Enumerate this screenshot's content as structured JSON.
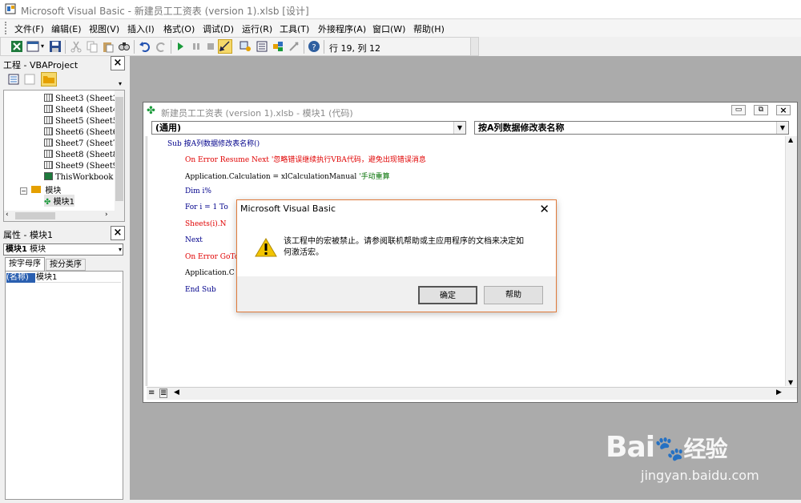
{
  "window": {
    "title": "Microsoft Visual Basic - 新建员工工资表 (version 1).xlsb [设计]"
  },
  "menu": [
    "文件(F)",
    "编辑(E)",
    "视图(V)",
    "插入(I)",
    "格式(O)",
    "调试(D)",
    "运行(R)",
    "工具(T)",
    "外接程序(A)",
    "窗口(W)",
    "帮助(H)"
  ],
  "toolbar": {
    "position": "行 19, 列 12"
  },
  "project_panel": {
    "title": "工程 - VBAProject",
    "items": [
      "Sheet3 (Sheet3",
      "Sheet4 (Sheet4",
      "Sheet5 (Sheet5",
      "Sheet6 (Sheet6",
      "Sheet7 (Sheet7",
      "Sheet8 (Sheet8",
      "Sheet9 (Sheet9",
      "ThisWorkbook"
    ],
    "folder": "模块",
    "module": "模块1"
  },
  "props_panel": {
    "title": "属性 - 模块1",
    "combo_bold": "模块1",
    "combo_rest": "模块",
    "tab_alpha": "按字母序",
    "tab_cat": "按分类序",
    "prop_name": "(名称)",
    "prop_value": "模块1"
  },
  "code_window": {
    "title": "新建员工工资表 (version 1).xlsb - 模块1 (代码)",
    "object_combo": "(通用)",
    "proc_combo": "按A列数据修改表名称",
    "lines": [
      {
        "a": "Sub 按A列数据修改表名称()",
        "b": "",
        "c": ""
      },
      {
        "a": "On Error Resume Next",
        "b": "'忽略错误继续执行VBA代码，避免出现错误消息",
        "c": ""
      },
      {
        "a": "Application.Calculation = xlCalculationManual",
        "b": "'手动重算",
        "c": ""
      },
      {
        "a": "Dim i%",
        "b": "",
        "c": ""
      },
      {
        "a": "For i = 1 To",
        "b": "",
        "c": ""
      },
      {
        "a": "Sheets(i).N",
        "b": "",
        "c": ""
      },
      {
        "a": "Next",
        "b": "",
        "c": ""
      },
      {
        "a": "On Error GoTo",
        "b": "",
        "c": ""
      },
      {
        "a": "Application.C",
        "b": "",
        "c": ""
      },
      {
        "a": "End Sub",
        "b": "",
        "c": ""
      }
    ]
  },
  "dialog": {
    "title": "Microsoft Visual Basic",
    "message": "该工程中的宏被禁止。请参阅联机帮助或主应用程序的文档来决定如何激活宏。",
    "ok": "确定",
    "help": "帮助"
  },
  "watermark": {
    "brand": "Bai",
    "brand2": "经验",
    "url": "jingyan.baidu.com"
  },
  "colors": {
    "dialog_border": "#e07a3a",
    "keyword": "#00008b",
    "error_red": "#e00000",
    "comment_green": "#007000",
    "mdi_bg": "#ababab"
  }
}
